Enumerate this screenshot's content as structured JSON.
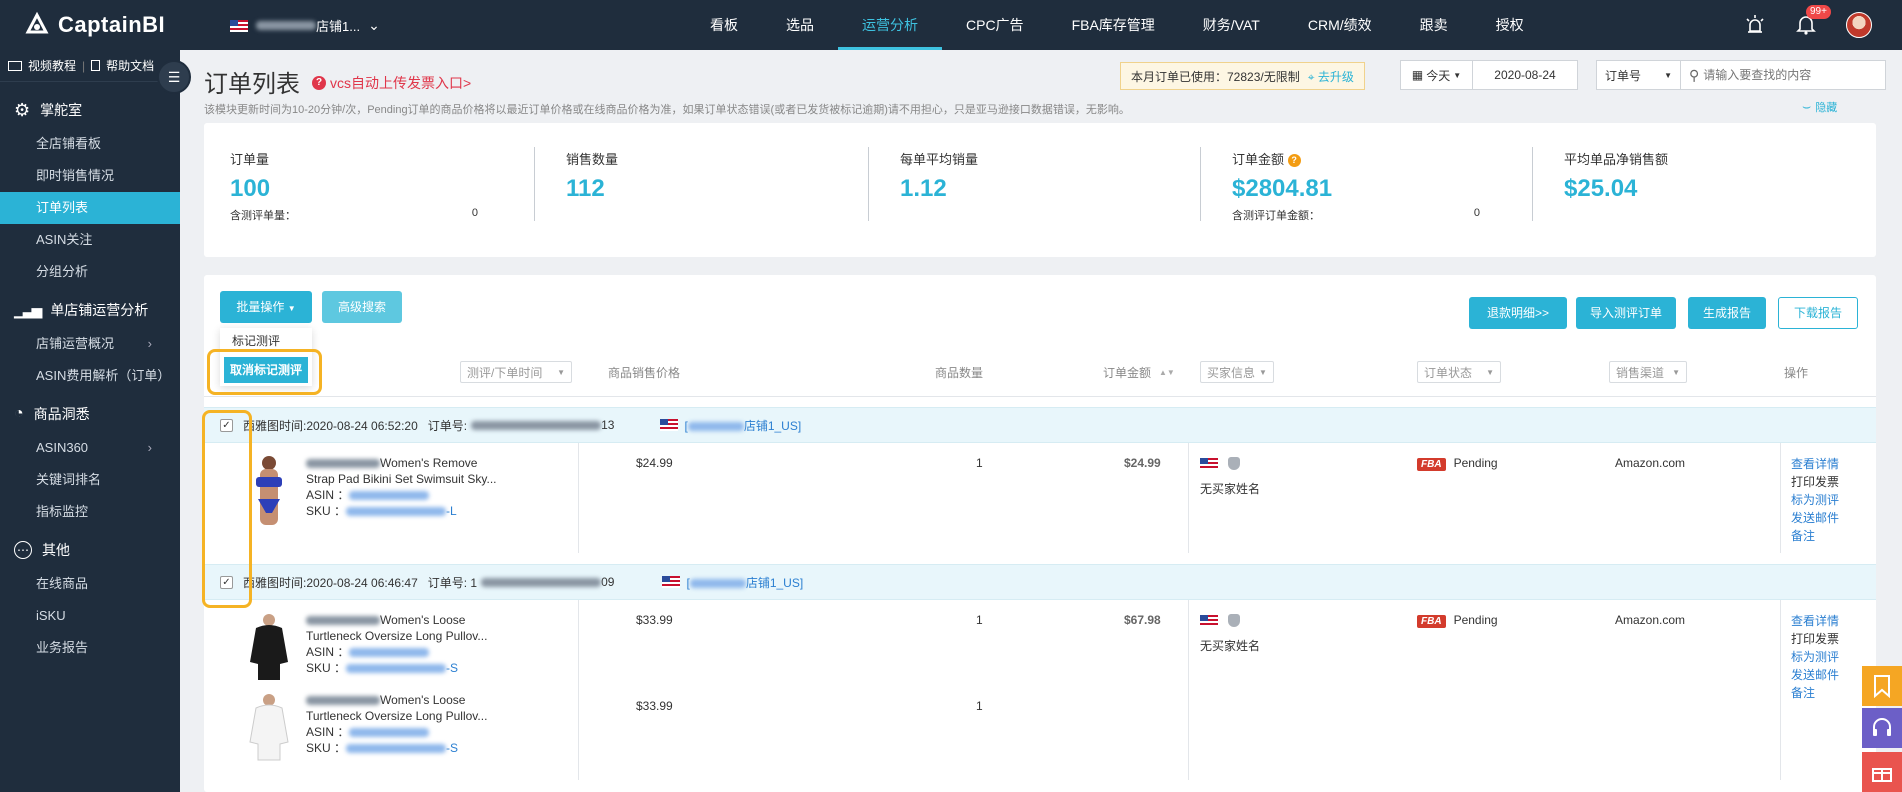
{
  "app": {
    "logo_text": "CaptainBI",
    "store_suffix": "店铺1..."
  },
  "nav": {
    "items": [
      "看板",
      "选品",
      "运营分析",
      "CPC广告",
      "FBA库存管理",
      "财务/VAT",
      "CRM/绩效",
      "跟卖",
      "授权"
    ],
    "active": "运营分析",
    "notification_badge": "99+"
  },
  "sidebar": {
    "video_tutorial": "视频教程",
    "help_doc": "帮助文档",
    "sections": [
      {
        "title": "掌舵室",
        "icon": "gear-icon",
        "items": [
          "全店铺看板",
          "即时销售情况",
          "订单列表",
          "ASIN关注",
          "分组分析"
        ]
      },
      {
        "title": "单店铺运营分析",
        "icon": "bar-chart-icon",
        "items": [
          "店铺运营概况",
          "ASIN费用解析（订单）"
        ]
      },
      {
        "title": "商品洞悉",
        "icon": "pie-icon",
        "items": [
          "ASIN360",
          "关键词排名",
          "指标监控"
        ]
      },
      {
        "title": "其他",
        "icon": "more-icon",
        "items": [
          "在线商品",
          "iSKU",
          "业务报告"
        ]
      }
    ],
    "active_item": "订单列表"
  },
  "header": {
    "title": "订单列表",
    "vcs_link": "vcs自动上传发票入口>",
    "note": "该模块更新时间为10-20分钟/次，Pending订单的商品价格将以最近订单价格或在线商品价格为准，如果订单状态错误(或者已发货被标记逾期)请不用担心，只是亚马逊接口数据错误，无影响。",
    "usage_text": "本月订单已使用：72823/无限制",
    "upgrade": "去升级",
    "date_range": "今天",
    "date": "2020-08-24",
    "search_type": "订单号",
    "search_placeholder": "请输入要查找的内容",
    "hide": "隐藏"
  },
  "stats": [
    {
      "label": "订单量",
      "value": "100",
      "sub_label": "含测评单量：",
      "sub_value": "0"
    },
    {
      "label": "销售数量",
      "value": "112"
    },
    {
      "label": "每单平均销量",
      "value": "1.12"
    },
    {
      "label": "订单金额",
      "value": "$2804.81",
      "sub_label": "含测评订单金额：",
      "sub_value": "0",
      "help": "?"
    },
    {
      "label": "平均单品净销售额",
      "value": "$25.04"
    }
  ],
  "toolbar": {
    "batch": "批量操作",
    "advanced": "高级搜索",
    "dropdown": [
      "标记测评",
      "取消标记测评"
    ],
    "refund": "退款明细>>",
    "import": "导入测评订单",
    "report": "生成报告",
    "download": "下载报告"
  },
  "table": {
    "headers": {
      "review_time": "测评/下单时间",
      "price": "商品销售价格",
      "qty": "商品数量",
      "amount": "订单金额",
      "buyer": "买家信息",
      "status": "订单状态",
      "channel": "销售渠道",
      "ops": "操作"
    }
  },
  "orders": [
    {
      "time": "西雅图时间:2020-08-24 06:52:20",
      "order_label": "订单号:",
      "order_tail": "13",
      "store_suffix": "店铺1_US",
      "amount": "$24.99",
      "buyer": "无买家姓名",
      "fulfillment": "FBA",
      "status": "Pending",
      "channel": "Amazon.com",
      "products": [
        {
          "title1": "Women's Remove",
          "title2": "Strap Pad Bikini Set Swimsuit Sky...",
          "asin_label": "ASIN ：",
          "sku_label": "SKU  ：",
          "sku_tail": "-L",
          "price": "$24.99",
          "qty": "1"
        }
      ]
    },
    {
      "time": "西雅图时间:2020-08-24 06:46:47",
      "order_label": "订单号: 1",
      "order_tail": "09",
      "store_suffix": "店铺1_US",
      "amount": "$67.98",
      "buyer": "无买家姓名",
      "fulfillment": "FBA",
      "status": "Pending",
      "channel": "Amazon.com",
      "products": [
        {
          "title1": "Women's Loose",
          "title2": "Turtleneck Oversize Long Pullov...",
          "asin_label": "ASIN ：",
          "sku_label": "SKU  ：",
          "sku_tail": "-S",
          "price": "$33.99",
          "qty": "1"
        },
        {
          "title1": "Women's Loose",
          "title2": "Turtleneck Oversize Long Pullov...",
          "asin_label": "ASIN ：",
          "sku_label": "SKU  ：",
          "sku_tail": "-S",
          "price": "$33.99",
          "qty": "1"
        }
      ]
    }
  ],
  "order_actions": [
    "查看详情",
    "打印发票",
    "标为测评",
    "发送邮件",
    "备注"
  ],
  "colors": {
    "accent": "#2bb3d6",
    "topbar": "#1f2d3d",
    "highlight": "#f5b324",
    "fba": "#d33b2c"
  }
}
